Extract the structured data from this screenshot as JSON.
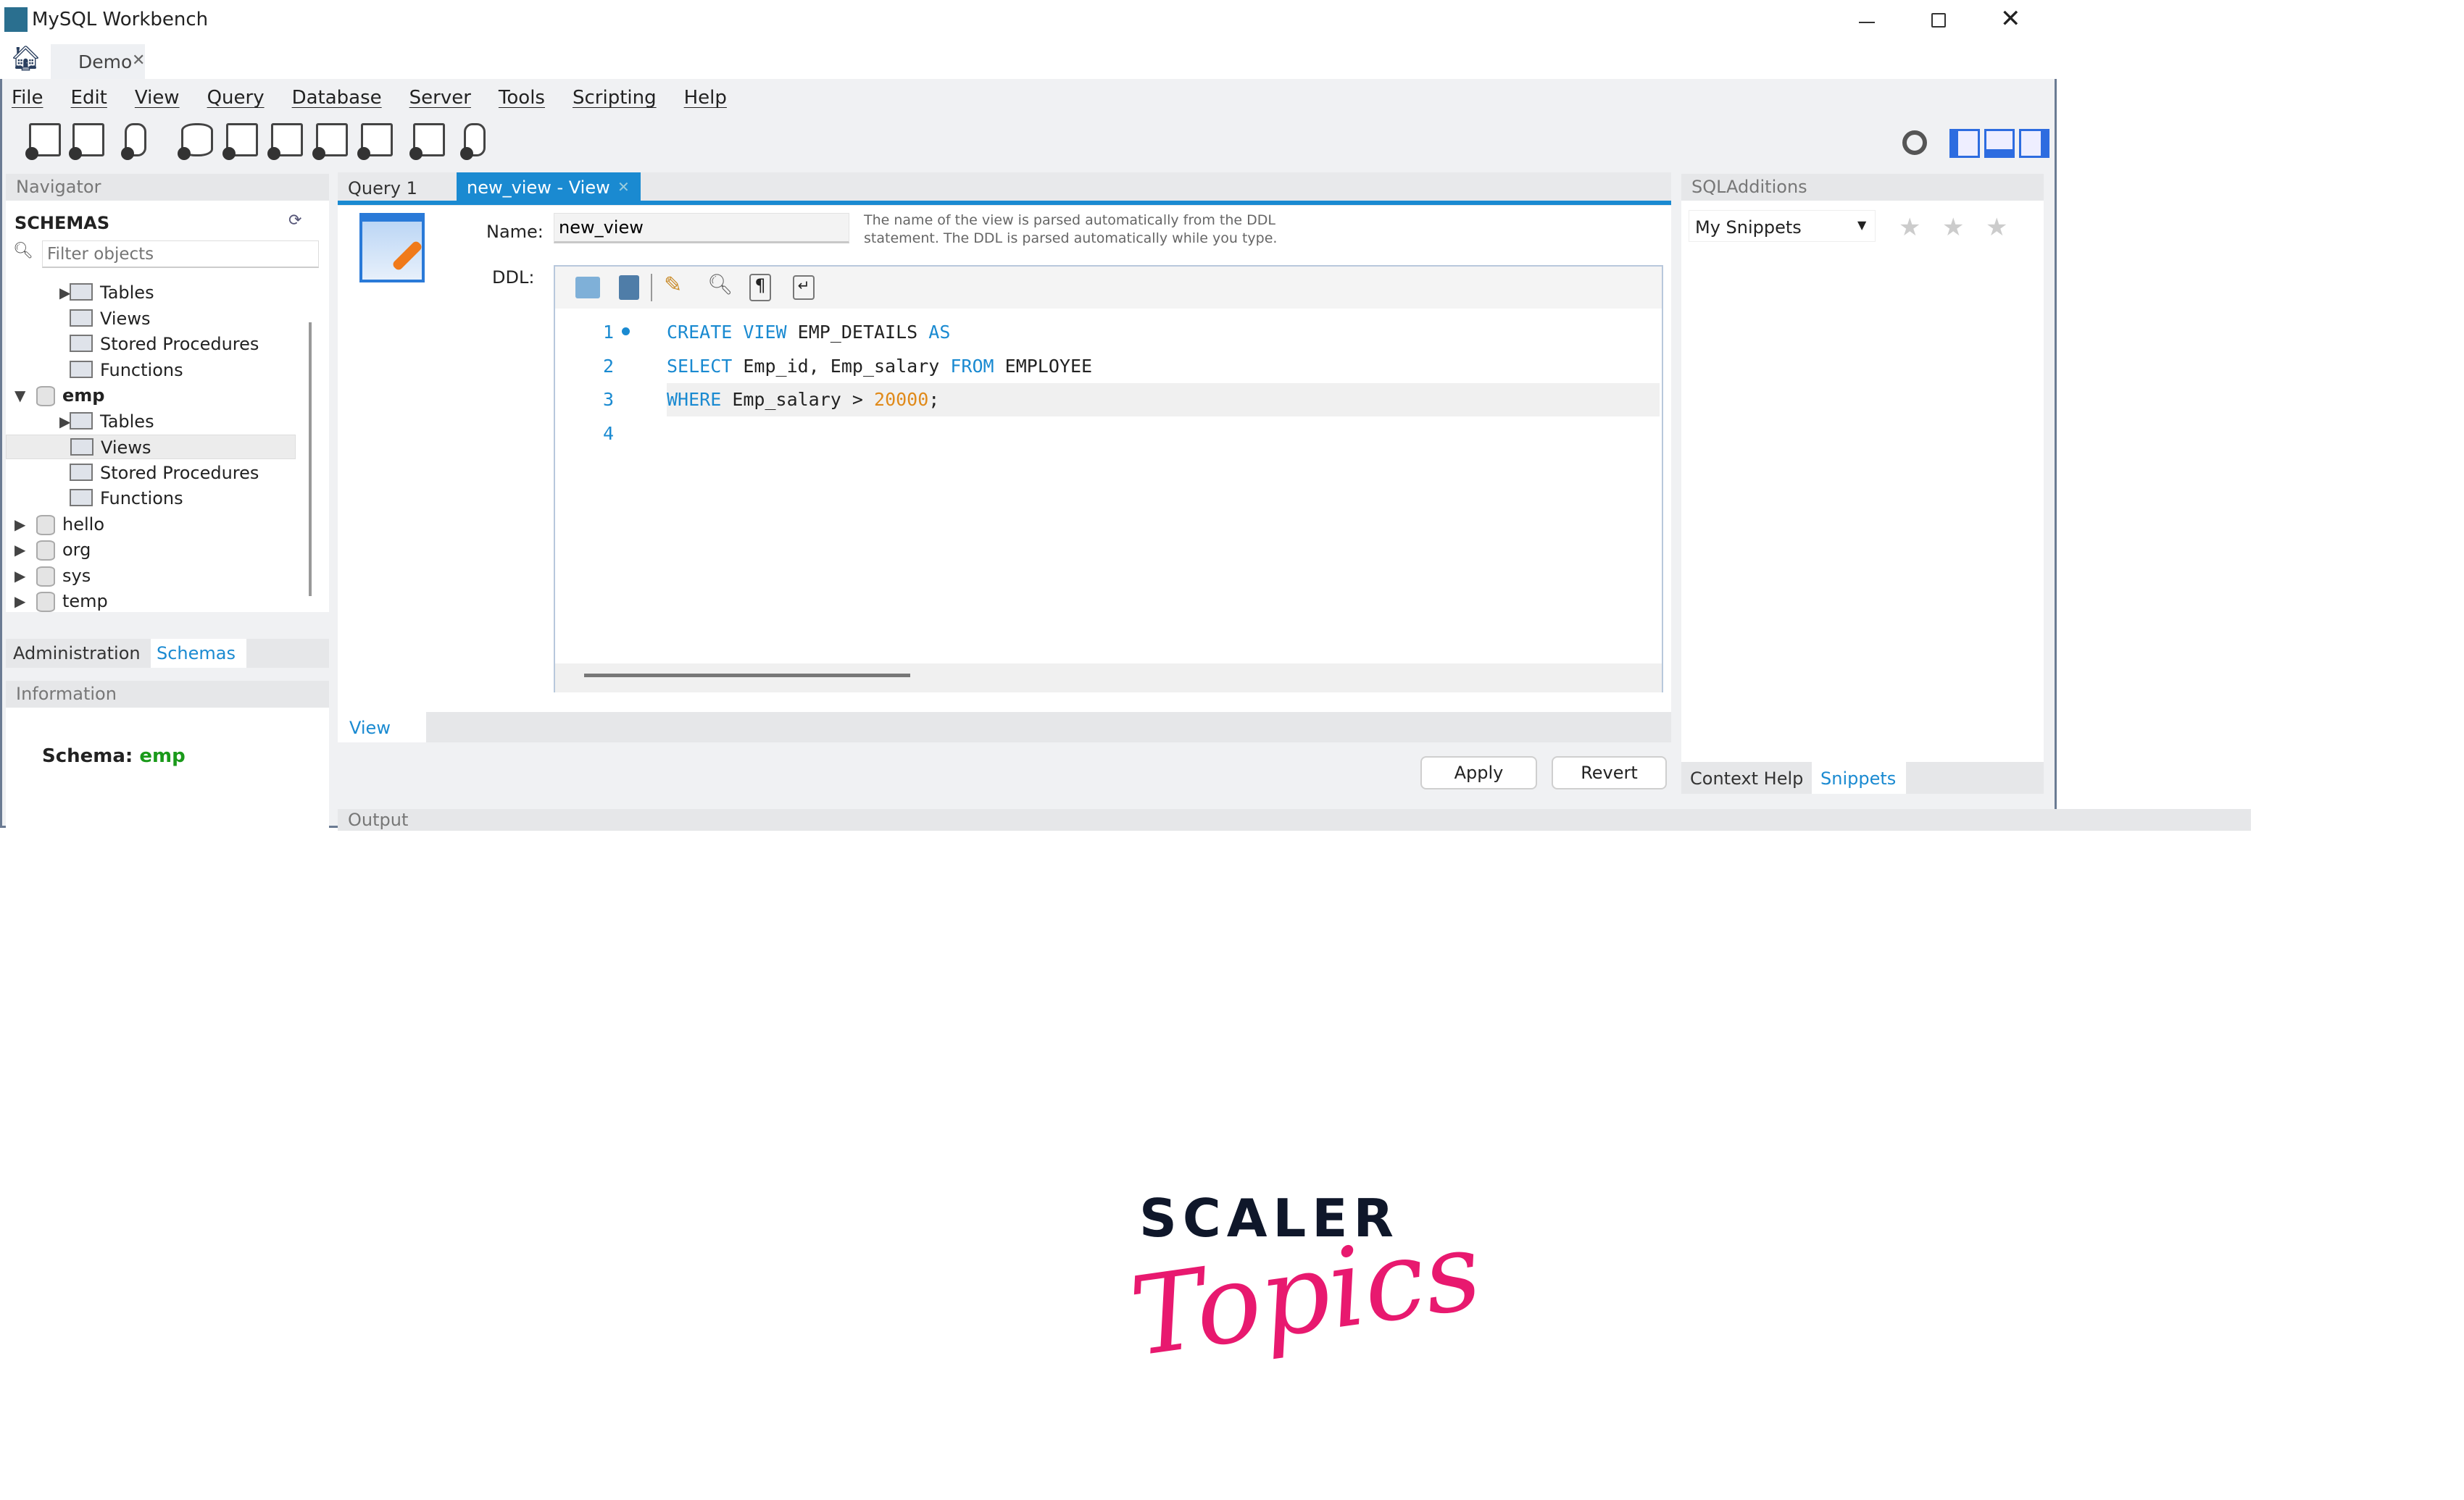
{
  "window": {
    "title": "MySQL Workbench",
    "tabs": [
      {
        "label": "Demo"
      }
    ]
  },
  "menu": [
    "File",
    "Edit",
    "View",
    "Query",
    "Database",
    "Server",
    "Tools",
    "Scripting",
    "Help"
  ],
  "navigator": {
    "header": "Navigator",
    "schemas_label": "SCHEMAS",
    "filter_placeholder": "Filter objects",
    "tree": [
      {
        "label": "Tables",
        "level": 1,
        "arrow": "right"
      },
      {
        "label": "Views",
        "level": 1
      },
      {
        "label": "Stored Procedures",
        "level": 1
      },
      {
        "label": "Functions",
        "level": 1
      },
      {
        "label": "emp",
        "level": 0,
        "arrow": "down",
        "bold": true
      },
      {
        "label": "Tables",
        "level": 1,
        "arrow": "right"
      },
      {
        "label": "Views",
        "level": 1,
        "selected": true
      },
      {
        "label": "Stored Procedures",
        "level": 1
      },
      {
        "label": "Functions",
        "level": 1
      },
      {
        "label": "hello",
        "level": 0,
        "arrow": "right"
      },
      {
        "label": "org",
        "level": 0,
        "arrow": "right"
      },
      {
        "label": "sys",
        "level": 0,
        "arrow": "right"
      },
      {
        "label": "temp",
        "level": 0,
        "arrow": "right"
      }
    ],
    "bottom_tabs": [
      "Administration",
      "Schemas"
    ],
    "active_bottom_tab": "Schemas"
  },
  "information": {
    "header": "Information",
    "schema_label": "Schema:",
    "schema_value": "emp"
  },
  "editor": {
    "tabs": [
      "Query 1",
      "new_view - View"
    ],
    "active_tab": "new_view - View",
    "name_label": "Name:",
    "name_value": "new_view",
    "description_line1": "The name of the view is parsed automatically from the DDL",
    "description_line2": "statement. The DDL is parsed automatically while you type.",
    "ddl_label": "DDL:",
    "lines": [
      {
        "n": "1",
        "tokens": [
          [
            "kw",
            "CREATE VIEW"
          ],
          [
            "",
            "EMP_DETAILS"
          ],
          [
            "kw",
            "AS"
          ]
        ]
      },
      {
        "n": "2",
        "tokens": [
          [
            "kw",
            "SELECT"
          ],
          [
            "",
            "Emp_id, Emp_salary"
          ],
          [
            "kw",
            "FROM"
          ],
          [
            "",
            "EMPLOYEE"
          ]
        ]
      },
      {
        "n": "3",
        "tokens": [
          [
            "kw",
            "WHERE"
          ],
          [
            "",
            "Emp_salary >"
          ],
          [
            "num",
            "20000"
          ],
          [
            "",
            ";"
          ]
        ]
      },
      {
        "n": "4",
        "tokens": []
      }
    ],
    "bottom_tab": "View",
    "apply_label": "Apply",
    "revert_label": "Revert"
  },
  "output": {
    "header": "Output"
  },
  "sql_additions": {
    "header": "SQLAdditions",
    "snippets_select": "My Snippets",
    "bottom_tabs": [
      "Context Help",
      "Snippets"
    ],
    "active_bottom_tab": "Snippets"
  },
  "logo": {
    "line1": "SCALER",
    "line2": "Topics"
  },
  "colors": {
    "accent": "#1a8ad1",
    "logo_pink": "#e8196f",
    "logo_dark": "#0f172a",
    "schema_green": "#1a9a1a"
  }
}
